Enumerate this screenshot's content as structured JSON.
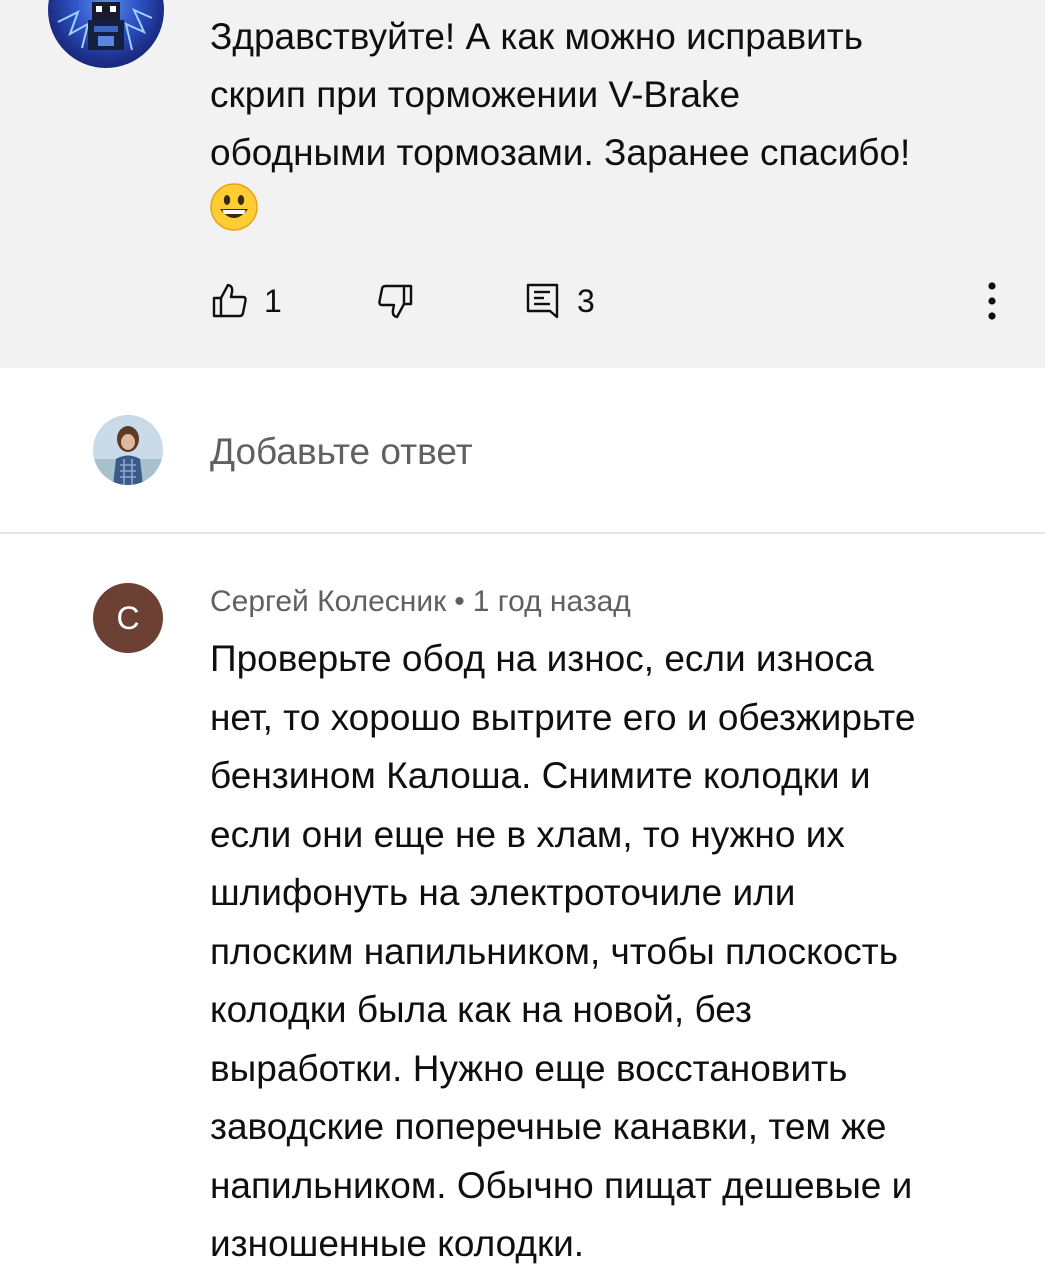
{
  "comment": {
    "text": "Здравствуйте! А как можно исправить\nскрип при торможении V-Brake\nободными тормозами. Заранее спасибо!",
    "emoji_icon": "grinning-face-emoji",
    "like_count": "1",
    "reply_count": "3"
  },
  "reply_box": {
    "placeholder": "Добавьте ответ"
  },
  "reply": {
    "avatar_letter": "С",
    "author": "Сергей Колесник",
    "separator": "•",
    "time": "1 год назад",
    "text": "Проверьте обод на износ, если износа\nнет, то хорошо вытрите его и обезжирьте\nбензином Калоша. Снимите колодки и\nесли они еще не в хлам, то нужно их\nшлифонуть на электроточиле или\nплоским напильником, чтобы плоскость\nколодки была как на новой, без\nвыработки. Нужно еще восстановить\nзаводские поперечные канавки, тем же\nнапильником. Обычно пищат дешевые и\nизношенные колодки.",
    "avatar_color": "#6d4034"
  },
  "colors": {
    "highlight_bg": "#f2f2f2",
    "primary_text": "#0f0f0f",
    "secondary_text": "#606060",
    "divider": "#e5e5e5"
  }
}
